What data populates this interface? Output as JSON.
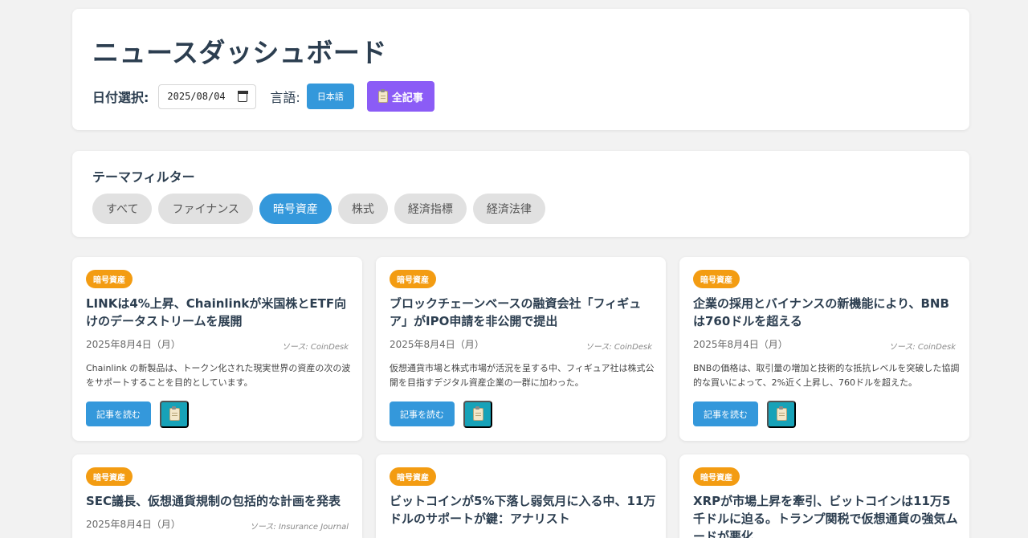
{
  "header": {
    "title": "ニュースダッシュボード",
    "date_label": "日付選択:",
    "date_value": "2025/08/04",
    "lang_label": "言語:",
    "lang_button": "日本語",
    "all_button": "全記事",
    "all_button_icon": "clipboard-icon"
  },
  "filter": {
    "title": "テーマフィルター",
    "chips": [
      "すべて",
      "ファイナンス",
      "暗号資産",
      "株式",
      "経済指標",
      "経済法律"
    ],
    "active": "暗号資産"
  },
  "colors": {
    "accent": "#3498db",
    "purple": "#8b5cf6",
    "badge": "#f39c12",
    "teal": "#17a2b8"
  },
  "cards": [
    {
      "badge": "暗号資産",
      "title": "LINKは4%上昇、Chainlinkが米国株とETF向けのデータストリームを展開",
      "date": "2025年8月4日（月）",
      "source": "ソース: CoinDesk",
      "summary": "Chainlink の新製品は、トークン化された現実世界の資産の次の波をサポートすることを目的としています。",
      "read_label": "記事を読む"
    },
    {
      "badge": "暗号資産",
      "title": "ブロックチェーンベースの融資会社「フィギュア」がIPO申請を非公開で提出",
      "date": "2025年8月4日（月）",
      "source": "ソース: CoinDesk",
      "summary": "仮想通貨市場と株式市場が活況を呈する中、フィギュア社は株式公開を目指すデジタル資産企業の一群に加わった。",
      "read_label": "記事を読む"
    },
    {
      "badge": "暗号資産",
      "title": "企業の採用とバイナンスの新機能により、BNBは760ドルを超える",
      "date": "2025年8月4日（月）",
      "source": "ソース: CoinDesk",
      "summary": "BNBの価格は、取引量の増加と技術的な抵抗レベルを突破した協調的な買いによって、2%近く上昇し、760ドルを超えた。",
      "read_label": "記事を読む"
    },
    {
      "badge": "暗号資産",
      "title": "SEC議長、仮想通貨規制の包括的な計画を発表",
      "date": "2025年8月4日（月）",
      "source": "ソース: Insurance Journal"
    },
    {
      "badge": "暗号資産",
      "title": "ビットコインが5%下落し弱気月に入る中、11万ドルのサポートが鍵：アナリスト"
    },
    {
      "badge": "暗号資産",
      "title": "XRPが市場上昇を牽引、ビットコインは11万5千ドルに迫る。トランプ関税で仮想通貨の強気ムードが悪化"
    }
  ]
}
